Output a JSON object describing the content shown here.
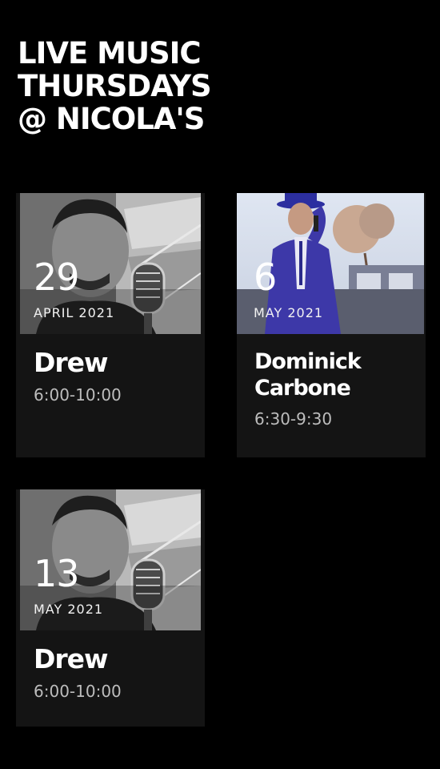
{
  "title": {
    "line1": "LIVE MUSIC",
    "line2": "THURSDAYS",
    "line3": "@ NICOLA'S"
  },
  "events": [
    {
      "day": "29",
      "month": "APRIL 2021",
      "performer": "Drew",
      "time": "6:00-10:00"
    },
    {
      "day": "6",
      "month": "MAY 2021",
      "performer": "Dominick Carbone",
      "time": "6:30-9:30"
    },
    {
      "day": "13",
      "month": "MAY 2021",
      "performer": "Drew",
      "time": "6:00-10:00"
    }
  ],
  "colors": {
    "background": "#000000",
    "card": "#141414",
    "text": "#ffffff",
    "muted": "#bdbdbd"
  }
}
